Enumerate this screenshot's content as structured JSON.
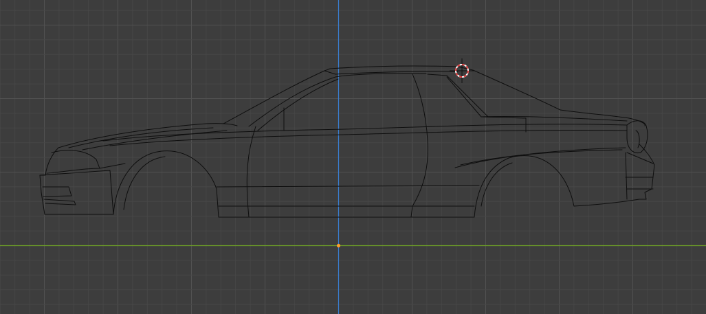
{
  "viewport": {
    "view": "side-orthographic",
    "background_color": "#3d3d3d",
    "grid_minor_color": "#474747",
    "grid_major_color": "#525252",
    "z_axis_color": "#3a7fd4",
    "y_axis_color": "#6ea026",
    "wireframe_color": "#0e0e0e",
    "origin_color": "#ff9f2a"
  },
  "icons": {
    "cursor": "3d-cursor-icon",
    "origin": "world-origin-icon"
  },
  "cursor_colors": {
    "ring_primary": "#e23b3b",
    "ring_secondary": "#ffffff",
    "crosshair": "#111111"
  },
  "mesh": {
    "name": "car-body-wireframe",
    "object_type": "side-profile-mesh"
  }
}
